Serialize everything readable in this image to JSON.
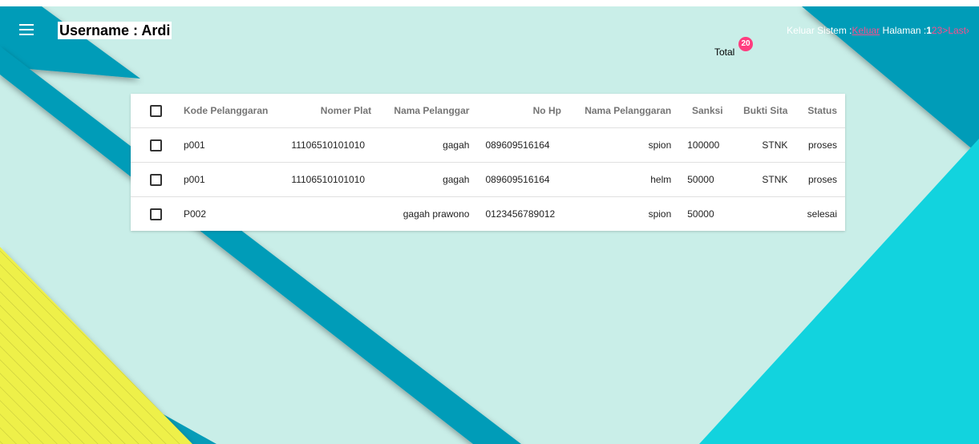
{
  "header": {
    "username": "Username : Ardi",
    "keluar_sistem": "Keluar Sistem :",
    "keluar": "Keluar",
    "halaman": " Halaman :",
    "current_page": "1",
    "pages": [
      "2",
      "3"
    ],
    "next": ">",
    "last": "Last",
    "last_chevron": "›",
    "total_label": "Total",
    "total_count": "20"
  },
  "table": {
    "columns": [
      "Kode Pelanggaran",
      "Nomer Plat",
      "Nama Pelanggar",
      "No Hp",
      "Nama Pelanggaran",
      "Sanksi",
      "Bukti Sita",
      "Status"
    ],
    "rows": [
      [
        "p001",
        "11106510101010",
        "gagah",
        "089609516164",
        "spion",
        "100000",
        "STNK",
        "proses"
      ],
      [
        "p001",
        "11106510101010",
        "gagah",
        "089609516164",
        "helm",
        "50000",
        "STNK",
        "proses"
      ],
      [
        "P002",
        "",
        "gagah prawono",
        "0123456789012",
        "spion",
        "50000",
        "",
        "selesai"
      ]
    ]
  },
  "icons": {
    "menu": "hamburger-menu-icon",
    "row_select": "checkbox-icon"
  },
  "colors": {
    "background": "#c9eee8",
    "stripe": "#069cb8",
    "accent_cyan": "#12d3de",
    "accent_yellow": "#eef04a",
    "link_pink": "#ff4d8d",
    "badge": "#ff3d7f"
  }
}
